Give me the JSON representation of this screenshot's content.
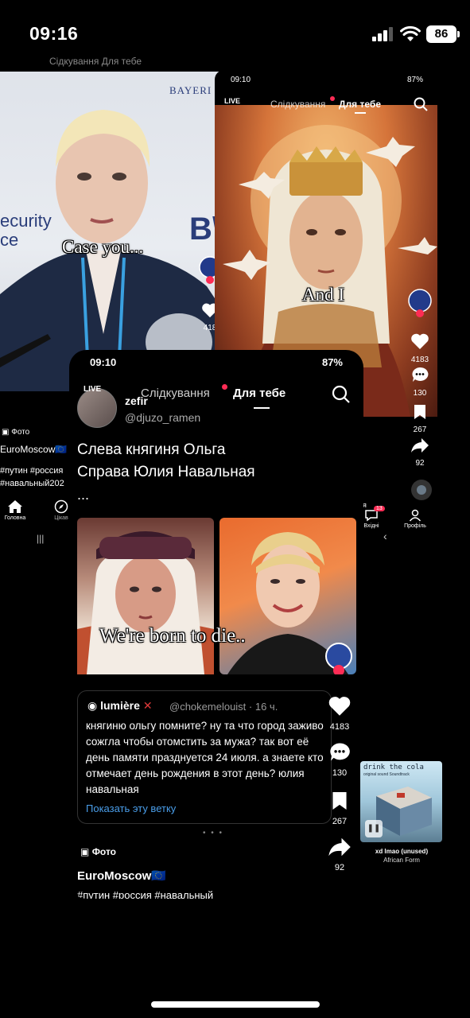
{
  "status_bar": {
    "time": "09:16",
    "battery": "86"
  },
  "shot_left": {
    "tab_ghost": "Сідкування  Для тебе",
    "bayer": "BAYERI",
    "security_line1": "ecurity",
    "security_line2": "ce",
    "brand_fragment": "B\\",
    "caption": "Case you...",
    "rail_count": "418",
    "foto_label": "Фото",
    "channel": "EuroMoscow🇪🇺",
    "tags_line1": "#путин #россия",
    "tags_line2": "#навальный202",
    "nav_home": "Головна",
    "nav_discover": "Цікав"
  },
  "shot_middle": {
    "time": "09:10",
    "battery": "87%",
    "tab_live": "LIVE",
    "tab_following": "Слідкування",
    "tab_foryou": "Для тебе",
    "caption": "And I",
    "rail": {
      "likes": "4183",
      "comments": "130",
      "saves": "267",
      "shares": "92"
    },
    "nav_inbox": "Вхідні",
    "nav_inbox_badge": "13",
    "nav_profile": "Профіль",
    "nav_letter": "я"
  },
  "shot_front": {
    "time": "09:10",
    "battery": "87%",
    "tab_live": "LIVE",
    "author": "zefir",
    "tab_following": "Слідкування",
    "tab_foryou": "Для тебе",
    "handle": "@djuzo_ramen",
    "post_line1": "Слева княгиня Ольга",
    "post_line2": "Справа Юлия Навальная",
    "more": "...",
    "caption": "We're born to die..",
    "tweet": {
      "author": "lumière",
      "handle": "@chokemelouist · 16 ч.",
      "body": "княгиню ольгу помните? ну та что город заживо сожгла чтобы отомстить за мужа? так вот её день памяти празднуется 24 июля. а знаете кто отмечает день рождения в этот день? юлия навальная",
      "link": "Показать эту ветку"
    },
    "rail": {
      "likes": "4183",
      "comments": "130",
      "saves": "267",
      "shares": "92"
    },
    "dots": "• • •",
    "foto_label": "Фото",
    "channel": "EuroMoscow🇪🇺",
    "tags": "#путин #россия #навальный"
  },
  "mini_player": {
    "cover_title": "drink the cola",
    "cover_sub": "original sound Soundtrack",
    "track": "xd lmao (unused)",
    "artist": "African Form"
  }
}
